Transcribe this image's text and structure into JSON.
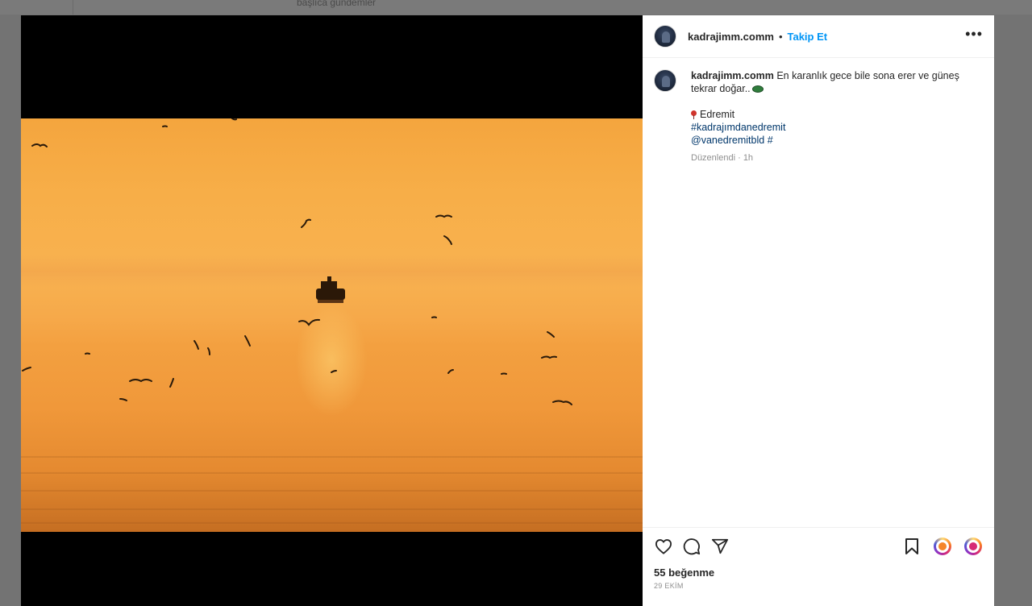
{
  "background": {
    "heading": "başlıca gündemler"
  },
  "post": {
    "username": "kadrajimm.comm",
    "separator": "•",
    "follow_label": "Takip Et",
    "more_label": "•••",
    "caption": {
      "text": "En karanlık gece bile sona erer ve güneş tekrar doğar..",
      "location": "Edremit",
      "hashtag": "#kadrajımdanedremit",
      "mention": "@vanedremitbld",
      "trailing_hash": "#"
    },
    "edited_meta": "Düzenlendi · 1h",
    "likes_label": "55 beğenme",
    "date_label": "29 EKİM"
  },
  "icons": {
    "like": "heart-icon",
    "comment": "comment-icon",
    "share": "send-icon",
    "save": "bookmark-icon",
    "extension_1": "extension-icon",
    "extension_2": "extension-icon"
  },
  "colors": {
    "follow": "#0095f6",
    "link": "#00376b",
    "sky_top": "#f4a53e",
    "sea_bottom": "#c56e22"
  }
}
